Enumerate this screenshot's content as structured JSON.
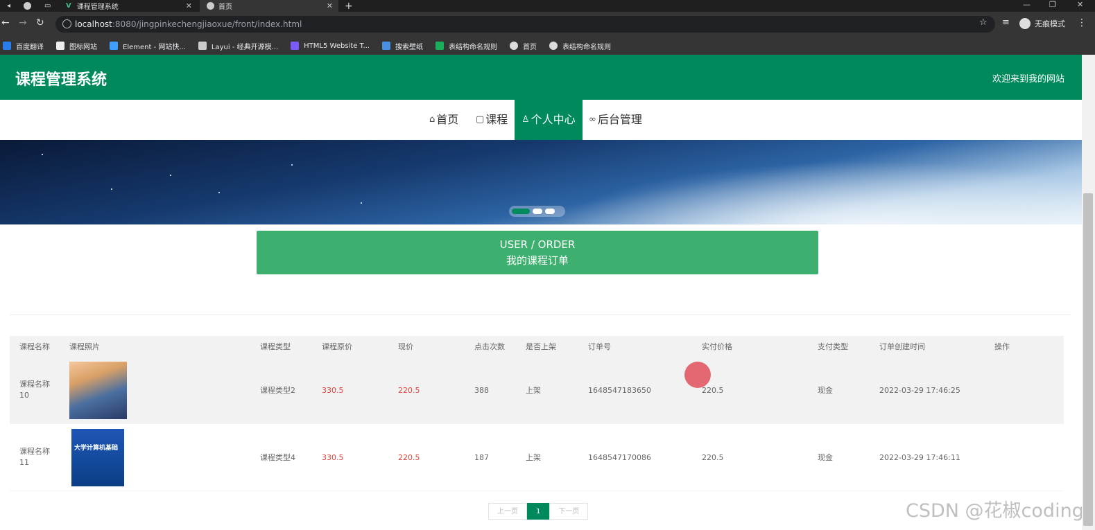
{
  "browser": {
    "tabs": [
      {
        "title": "课程管理系统"
      },
      {
        "title": "首页"
      }
    ],
    "url_host": "localhost",
    "url_rest": ":8080/jingpinkechengjiaoxue/front/index.html",
    "profile_label": "无痕模式",
    "bookmarks": [
      "百度翻译",
      "图标网站",
      "Element - 网站快...",
      "Layui - 经典开源模...",
      "HTML5 Website T...",
      "搜索壁纸",
      "表结构命名规则",
      "首页",
      "表结构命名规则"
    ]
  },
  "header": {
    "title": "课程管理系统",
    "welcome": "欢迎来到我的网站"
  },
  "menu": {
    "items": [
      {
        "icon": "home-icon",
        "label": "首页"
      },
      {
        "icon": "doc-icon",
        "label": "课程"
      },
      {
        "icon": "user-icon",
        "label": "个人中心"
      },
      {
        "icon": "link-icon",
        "label": "后台管理"
      }
    ],
    "active": "个人中心"
  },
  "section": {
    "en": "USER / ORDER",
    "cn": "我的课程订单"
  },
  "table": {
    "headers": [
      "课程名称",
      "课程照片",
      "课程类型",
      "课程原价",
      "现价",
      "点击次数",
      "是否上架",
      "订单号",
      "实付价格",
      "支付类型",
      "订单创建时间",
      "操作"
    ],
    "rows": [
      {
        "name": "课程名称10",
        "type": "课程类型2",
        "orig_price": "330.5",
        "price": "220.5",
        "clicks": "388",
        "status": "上架",
        "order_no": "1648547183650",
        "paid": "220.5",
        "pay_type": "现金",
        "created": "2022-03-29 17:46:25"
      },
      {
        "name": "课程名称11",
        "type": "课程类型4",
        "orig_price": "330.5",
        "price": "220.5",
        "clicks": "187",
        "status": "上架",
        "order_no": "1648547170086",
        "paid": "220.5",
        "pay_type": "现金",
        "created": "2022-03-29 17:46:11"
      }
    ]
  },
  "pagination": {
    "prev": "上一页",
    "current": "1",
    "next": "下一页"
  },
  "book_cover_text": "大学计算机基础",
  "watermark": "CSDN @花椒coding"
}
